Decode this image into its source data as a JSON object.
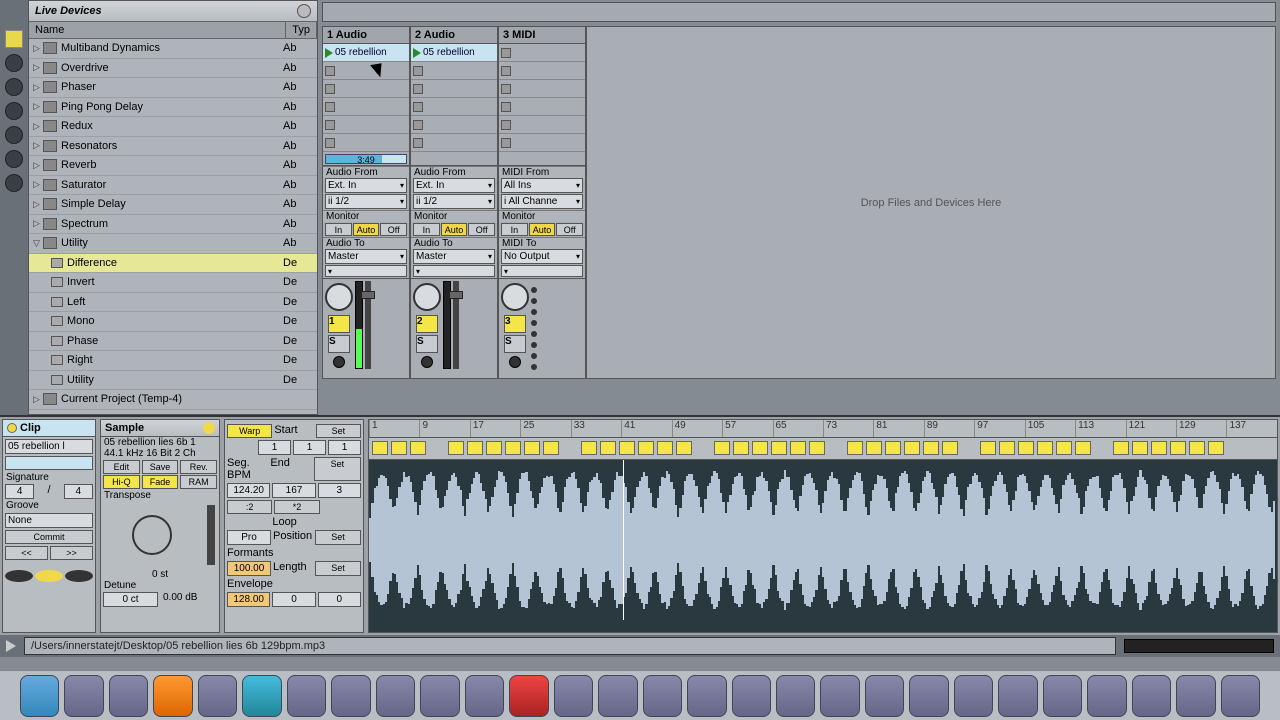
{
  "browser": {
    "title": "Live Devices",
    "cols": {
      "name": "Name",
      "type": "Typ"
    },
    "items": [
      {
        "name": "Multiband Dynamics",
        "type": "Ab"
      },
      {
        "name": "Overdrive",
        "type": "Ab"
      },
      {
        "name": "Phaser",
        "type": "Ab"
      },
      {
        "name": "Ping Pong Delay",
        "type": "Ab"
      },
      {
        "name": "Redux",
        "type": "Ab"
      },
      {
        "name": "Resonators",
        "type": "Ab"
      },
      {
        "name": "Reverb",
        "type": "Ab"
      },
      {
        "name": "Saturator",
        "type": "Ab"
      },
      {
        "name": "Simple Delay",
        "type": "Ab"
      },
      {
        "name": "Spectrum",
        "type": "Ab"
      },
      {
        "name": "Utility",
        "type": "Ab",
        "expanded": true
      }
    ],
    "children": [
      {
        "name": "Difference",
        "type": "De",
        "selected": true
      },
      {
        "name": "Invert",
        "type": "De"
      },
      {
        "name": "Left",
        "type": "De"
      },
      {
        "name": "Mono",
        "type": "De"
      },
      {
        "name": "Phase",
        "type": "De"
      },
      {
        "name": "Right",
        "type": "De"
      },
      {
        "name": "Utility",
        "type": "De"
      }
    ],
    "project": {
      "name": "Current Project (Temp-4)"
    }
  },
  "tracks": [
    {
      "name": "1 Audio",
      "clip": "05 rebellion",
      "from_label": "Audio From",
      "from": "Ext. In",
      "chan": "ii 1/2",
      "monitor": "Monitor",
      "mon_in": "In",
      "mon_auto": "Auto",
      "mon_off": "Off",
      "to_label": "Audio To",
      "to": "Master",
      "num": "1",
      "solo": "S",
      "status": "3:49"
    },
    {
      "name": "2 Audio",
      "clip": "05 rebellion",
      "from_label": "Audio From",
      "from": "Ext. In",
      "chan": "ii 1/2",
      "monitor": "Monitor",
      "mon_in": "In",
      "mon_auto": "Auto",
      "mon_off": "Off",
      "to_label": "Audio To",
      "to": "Master",
      "num": "2",
      "solo": "S"
    },
    {
      "name": "3 MIDI",
      "from_label": "MIDI From",
      "from": "All Ins",
      "chan": "i All Channe",
      "monitor": "Monitor",
      "mon_in": "In",
      "mon_auto": "Auto",
      "mon_off": "Off",
      "to_label": "MIDI To",
      "to": "No Output",
      "num": "3",
      "solo": "S"
    }
  ],
  "drop": "Drop Files and Devices Here",
  "clip": {
    "title": "Clip",
    "name": "05 rebellion l",
    "sig_label": "Signature",
    "sig_a": "4",
    "sig_b": "4",
    "groove_label": "Groove",
    "groove": "None",
    "commit": "Commit",
    "prev": "<<",
    "next": ">>"
  },
  "sample": {
    "title": "Sample",
    "file": "05 rebellion lies 6b 1",
    "meta": "44.1 kHz 16 Bit 2 Ch",
    "edit": "Edit",
    "save": "Save",
    "rev": "Rev.",
    "hiq": "Hi-Q",
    "fade": "Fade",
    "ram": "RAM",
    "transpose": "Transpose",
    "transpose_val": "0 st",
    "detune": "Detune",
    "detune_val": "0 ct",
    "gain": "0.00 dB"
  },
  "notes": {
    "warp": "Warp",
    "start": "Start",
    "set": "Set",
    "end": "End",
    "r1a": "1",
    "r1b": "1",
    "r1c": "1",
    "segbpm": "Seg. BPM",
    "bpm": "124.20",
    "r2b": "167",
    "r2c": "3",
    "half": ":2",
    "double": "*2",
    "formants_label": "Formants",
    "formants": "100.00",
    "pro": "Pro",
    "envelope_label": "Envelope",
    "envelope": "128.00",
    "loop": "Loop",
    "position": "Position",
    "length": "Length",
    "p1": "0",
    "p2": "0"
  },
  "ruler": [
    "1",
    "9",
    "17",
    "25",
    "33",
    "41",
    "49",
    "57",
    "65",
    "73",
    "81",
    "89",
    "97",
    "105",
    "113",
    "121",
    "129",
    "137"
  ],
  "status": {
    "path": "/Users/innerstatejt/Desktop/05 rebellion lies 6b 129bpm.mp3"
  }
}
